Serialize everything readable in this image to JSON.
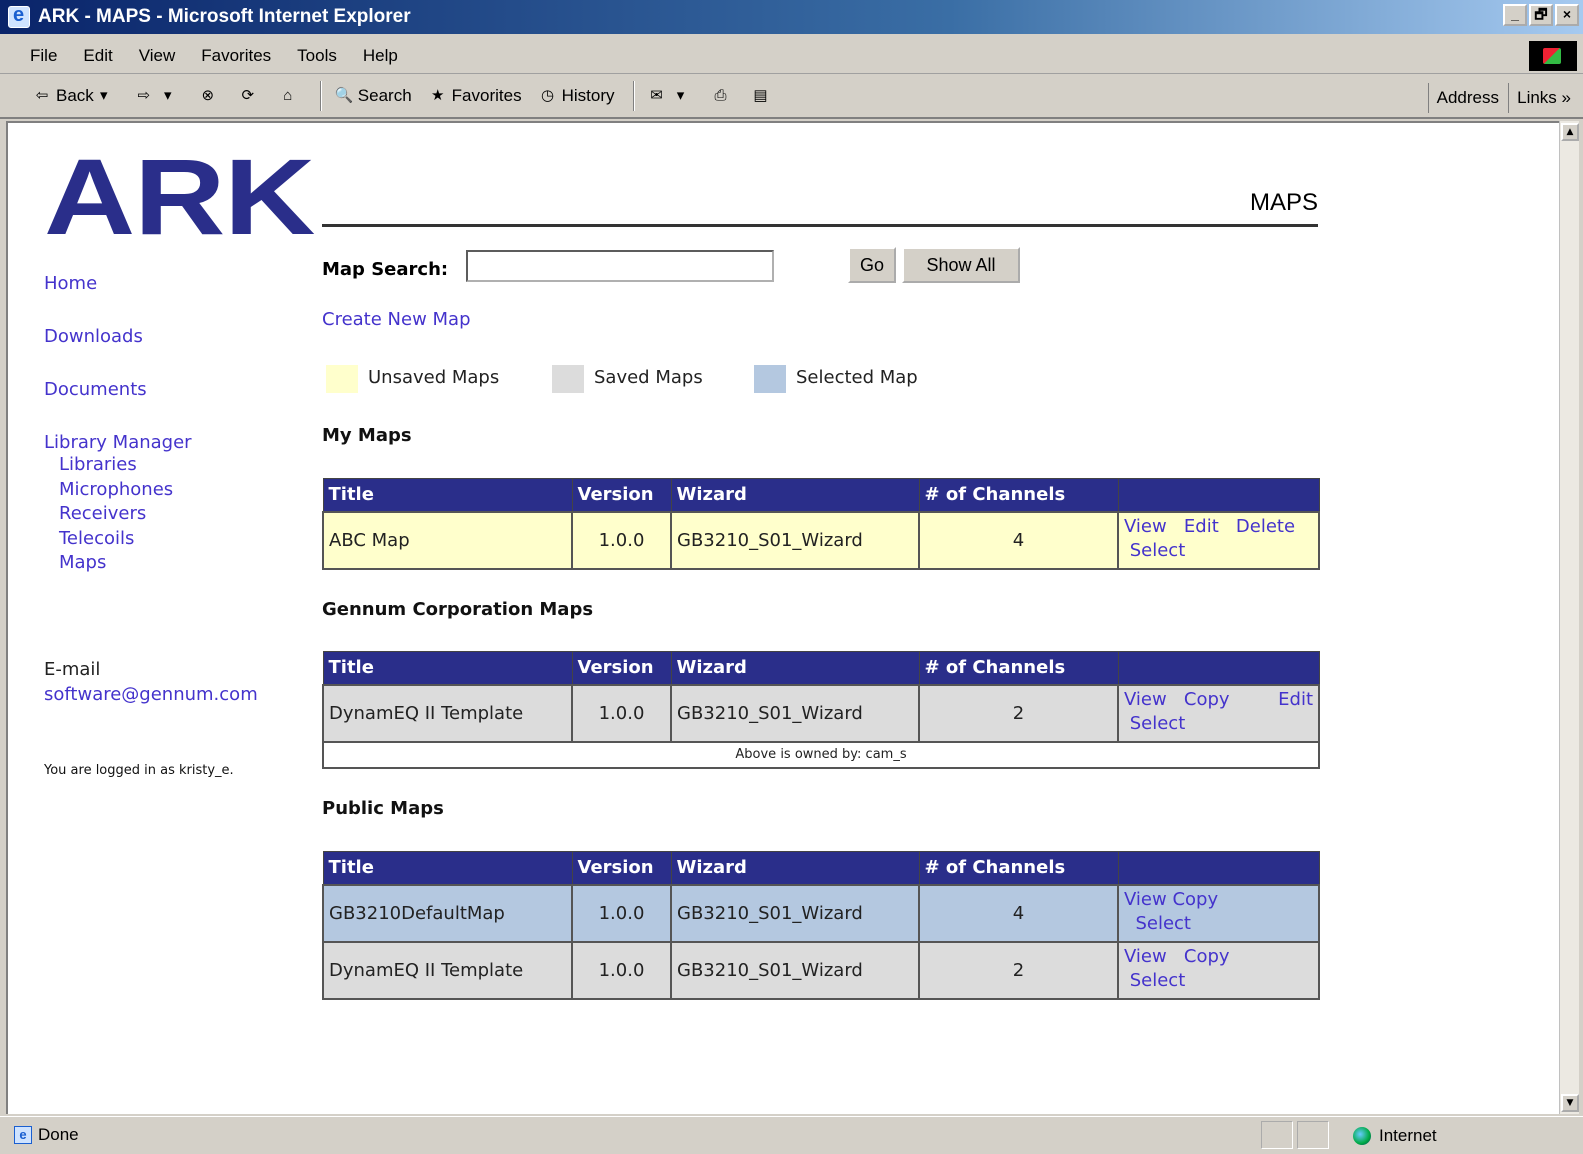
{
  "window": {
    "title": "ARK - MAPS - Microsoft Internet Explorer",
    "controls": [
      "_",
      "🗗",
      "×"
    ]
  },
  "menu": [
    "File",
    "Edit",
    "View",
    "Favorites",
    "Tools",
    "Help"
  ],
  "toolbar": {
    "back": "Back",
    "search": "Search",
    "favorites": "Favorites",
    "history": "History",
    "address": "Address",
    "links": "Links »"
  },
  "status": {
    "text": "Done",
    "zone": "Internet"
  },
  "brand": {
    "logo": "ARK",
    "page_title": "MAPS",
    "logo_color": "#2a2e8a"
  },
  "nav": {
    "home": "Home",
    "downloads": "Downloads",
    "documents": "Documents",
    "library_manager": "Library Manager",
    "sub": [
      "Libraries",
      "Microphones",
      "Receivers",
      "Telecoils",
      "Maps"
    ],
    "email_label": "E-mail",
    "email": "software@gennum.com",
    "logged_in": "You are logged in as kristy_e."
  },
  "search": {
    "label": "Map Search:",
    "value": "",
    "go": "Go",
    "show_all": "Show All"
  },
  "create_link": "Create New Map",
  "legend": [
    {
      "label": "Unsaved Maps",
      "color": "#ffffcc"
    },
    {
      "label": "Saved Maps",
      "color": "#dcdcdc"
    },
    {
      "label": "Selected Map",
      "color": "#b4c8e0"
    }
  ],
  "columns": [
    "Title",
    "Version",
    "Wizard",
    "# of Channels",
    ""
  ],
  "sections": {
    "my_maps": {
      "title": "My Maps",
      "rows": [
        {
          "title": "ABC Map",
          "version": "1.0.0",
          "wizard": "GB3210_S01_Wizard",
          "channels": "4",
          "actions": [
            "View",
            "Edit",
            "Delete",
            "Select"
          ]
        }
      ]
    },
    "gennum_maps": {
      "title": "Gennum Corporation Maps",
      "rows": [
        {
          "title": "DynamEQ II Template",
          "version": "1.0.0",
          "wizard": "GB3210_S01_Wizard",
          "channels": "2",
          "actions": [
            "View",
            "Copy",
            "Edit",
            "Select"
          ]
        }
      ],
      "owner_note": "Above is owned by: cam_s"
    },
    "public_maps": {
      "title": "Public Maps",
      "rows": [
        {
          "title": "GB3210DefaultMap",
          "version": "1.0.0",
          "wizard": "GB3210_S01_Wizard",
          "channels": "4",
          "actions": [
            "View",
            "Copy",
            "Select"
          ]
        },
        {
          "title": "DynamEQ II Template",
          "version": "1.0.0",
          "wizard": "GB3210_S01_Wizard",
          "channels": "2",
          "actions": [
            "View",
            "Copy",
            "Select"
          ]
        }
      ]
    }
  }
}
